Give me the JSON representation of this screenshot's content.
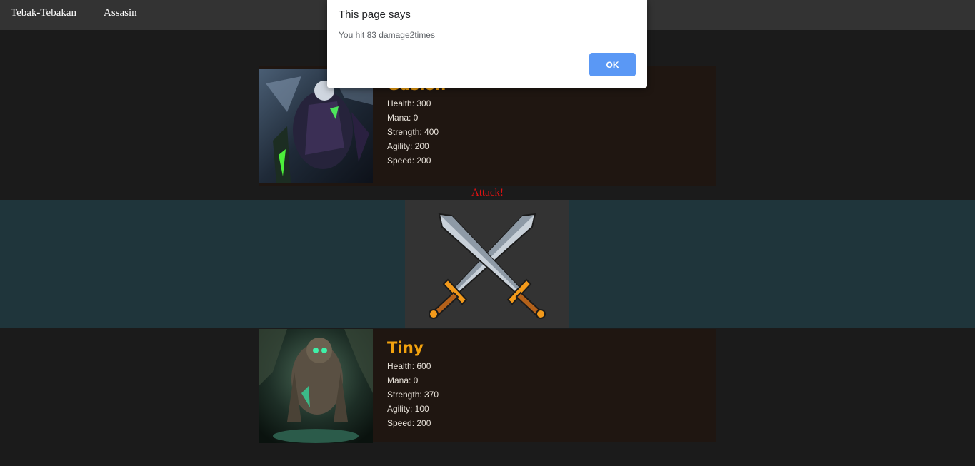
{
  "nav": {
    "links": [
      "Tebak-Tebakan",
      "Assasin"
    ]
  },
  "heroes": [
    {
      "name": "Gusion",
      "stats": [
        "Health: 300",
        "Mana: 0",
        "Strength: 400",
        "Agility: 200",
        "Speed: 200"
      ]
    },
    {
      "name": "Tiny",
      "stats": [
        "Health: 600",
        "Mana: 0",
        "Strength: 370",
        "Agility: 100",
        "Speed: 200"
      ]
    }
  ],
  "attack_label": "Attack!",
  "dialog": {
    "title": "This page says",
    "message": "You hit 83 damage2times",
    "ok_label": "OK"
  }
}
